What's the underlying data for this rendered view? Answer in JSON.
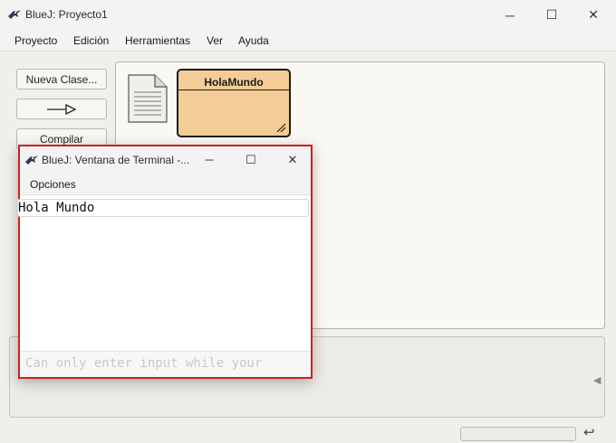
{
  "main_window": {
    "title": "BlueJ: Proyecto1",
    "controls": {
      "minimize": "─",
      "maximize": "☐",
      "close": "✕"
    }
  },
  "menubar": {
    "items": [
      "Proyecto",
      "Edición",
      "Herramientas",
      "Ver",
      "Ayuda"
    ]
  },
  "toolbar": {
    "new_class_label": "Nueva Clase...",
    "arrow_label": "—▷",
    "compile_label": "Compilar"
  },
  "diagram": {
    "class_name": "HolaMundo",
    "class_fill": "#f3cd95"
  },
  "terminal": {
    "title": "BlueJ: Ventana de Terminal -...",
    "controls": {
      "minimize": "─",
      "maximize": "☐",
      "close": "✕"
    },
    "menu_label": "Opciones",
    "output": "Hola Mundo",
    "input_placeholder": "Can only enter input while your",
    "border_color": "#d11f1f"
  },
  "icons": {
    "app": "bluej-bird-icon",
    "readme": "readme-document-icon",
    "panel_scroll": "arrow-left-icon",
    "return": "return-icon"
  }
}
